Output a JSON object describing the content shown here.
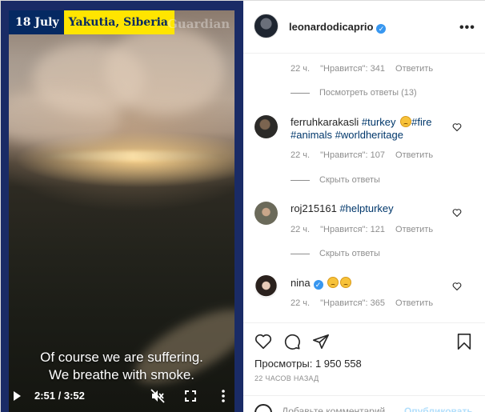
{
  "video": {
    "date_tag": "18 July",
    "place_tag": "Yakutia, Siberia",
    "watermark": "Guardian",
    "caption_line1": "Of course we are suffering.",
    "caption_line2": "We breathe with smoke.",
    "time": "2:51 / 3:52",
    "controls": {
      "play_icon": "play-icon",
      "mute_icon": "mute-icon",
      "fullscreen_icon": "fullscreen-icon",
      "more_icon": "more-vertical-icon"
    }
  },
  "header": {
    "username": "leonardodicaprio",
    "verified_mark": "✓",
    "more": "•••"
  },
  "comments": {
    "top_meta": {
      "time": "22 ч.",
      "likes": "\"Нравится\": 341",
      "reply": "Ответить"
    },
    "top_thread": "Посмотреть ответы (13)",
    "c1": {
      "username": "ferruhkarakasli",
      "tag1": "#turkey",
      "tag2": "#fire",
      "tag3": "#animals",
      "tag4": "#worldheritage",
      "meta": {
        "time": "22 ч.",
        "likes": "\"Нравится\": 107",
        "reply": "Ответить"
      },
      "thread": "Скрыть ответы"
    },
    "c2": {
      "username": "roj215161",
      "tag1": "#helpturkey",
      "meta": {
        "time": "22 ч.",
        "likes": "\"Нравится\": 121",
        "reply": "Ответить"
      },
      "thread": "Скрыть ответы"
    },
    "c3": {
      "username": "nina",
      "verified_mark": "✓",
      "meta": {
        "time": "22 ч.",
        "likes": "\"Нравится\": 365",
        "reply": "Ответить"
      }
    }
  },
  "actions": {
    "views_label": "Просмотры:",
    "views_count": "1 950 558",
    "timestamp": "22 ЧАСОВ НАЗАД"
  },
  "add_comment": {
    "placeholder": "Добавьте комментарий...",
    "publish": "Опубликовать"
  },
  "colors": {
    "accent": "#3897f0",
    "hashtag": "#00376b",
    "guardian_blue": "#052962",
    "guardian_yellow": "#ffe500"
  }
}
